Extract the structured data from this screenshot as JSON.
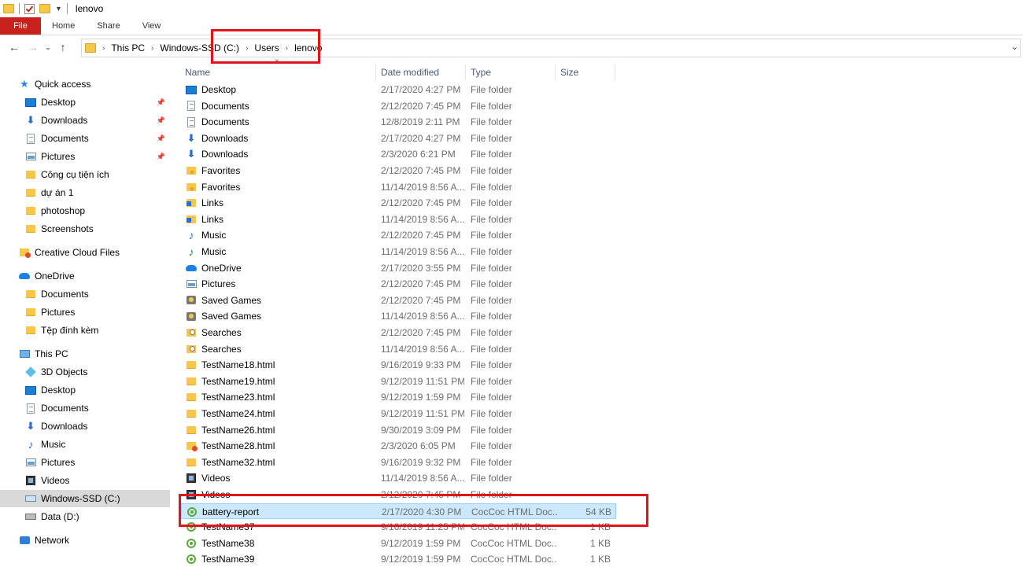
{
  "window": {
    "title": "lenovo"
  },
  "ribbon": {
    "file": "File",
    "tabs": [
      "Home",
      "Share",
      "View"
    ]
  },
  "address": {
    "crumbs": [
      "This PC",
      "Windows-SSD (C:)",
      "Users",
      "lenovo"
    ]
  },
  "sidebar": {
    "items": [
      {
        "label": "Quick access",
        "icon": "star-icon",
        "pinned": false
      },
      {
        "label": "Desktop",
        "icon": "desktop-icon",
        "pinned": true
      },
      {
        "label": "Downloads",
        "icon": "download-icon",
        "pinned": true
      },
      {
        "label": "Documents",
        "icon": "document-icon",
        "pinned": true
      },
      {
        "label": "Pictures",
        "icon": "pictures-icon",
        "pinned": true
      },
      {
        "label": "Công cụ tiện ích",
        "icon": "folder-icon",
        "pinned": false
      },
      {
        "label": "dự án 1",
        "icon": "folder-icon",
        "pinned": false
      },
      {
        "label": "photoshop",
        "icon": "folder-icon",
        "pinned": false
      },
      {
        "label": "Screenshots",
        "icon": "folder-icon",
        "pinned": false
      },
      {
        "label": "Creative Cloud Files",
        "icon": "creative-cloud-icon",
        "pinned": false
      },
      {
        "label": "OneDrive",
        "icon": "cloud-icon",
        "pinned": false
      },
      {
        "label": "Documents",
        "icon": "folder-icon",
        "pinned": false
      },
      {
        "label": "Pictures",
        "icon": "folder-icon",
        "pinned": false
      },
      {
        "label": "Tệp đính kèm",
        "icon": "folder-icon",
        "pinned": false
      },
      {
        "label": "This PC",
        "icon": "computer-icon",
        "pinned": false
      },
      {
        "label": "3D Objects",
        "icon": "3d-objects-icon",
        "pinned": false
      },
      {
        "label": "Desktop",
        "icon": "desktop-icon",
        "pinned": false
      },
      {
        "label": "Documents",
        "icon": "document-icon",
        "pinned": false
      },
      {
        "label": "Downloads",
        "icon": "download-icon",
        "pinned": false
      },
      {
        "label": "Music",
        "icon": "music-icon",
        "pinned": false
      },
      {
        "label": "Pictures",
        "icon": "pictures-icon",
        "pinned": false
      },
      {
        "label": "Videos",
        "icon": "videos-icon",
        "pinned": false
      },
      {
        "label": "Windows-SSD (C:)",
        "icon": "drive-c-icon",
        "pinned": false,
        "selected": true
      },
      {
        "label": "Data (D:)",
        "icon": "drive-icon",
        "pinned": false
      },
      {
        "label": "Network",
        "icon": "network-icon",
        "pinned": false
      }
    ]
  },
  "columns": {
    "name": "Name",
    "date": "Date modified",
    "type": "Type",
    "size": "Size"
  },
  "files": [
    {
      "name": "Desktop",
      "date": "2/17/2020 4:27 PM",
      "type": "File folder",
      "size": "",
      "icon": "desktop-icon"
    },
    {
      "name": "Documents",
      "date": "2/12/2020 7:45 PM",
      "type": "File folder",
      "size": "",
      "icon": "document-icon"
    },
    {
      "name": "Documents",
      "date": "12/8/2019 2:11 PM",
      "type": "File folder",
      "size": "",
      "icon": "document-icon"
    },
    {
      "name": "Downloads",
      "date": "2/17/2020 4:27 PM",
      "type": "File folder",
      "size": "",
      "icon": "download-icon"
    },
    {
      "name": "Downloads",
      "date": "2/3/2020 6:21 PM",
      "type": "File folder",
      "size": "",
      "icon": "download-icon"
    },
    {
      "name": "Favorites",
      "date": "2/12/2020 7:45 PM",
      "type": "File folder",
      "size": "",
      "icon": "favorites-icon"
    },
    {
      "name": "Favorites",
      "date": "11/14/2019 8:56 A...",
      "type": "File folder",
      "size": "",
      "icon": "favorites-icon"
    },
    {
      "name": "Links",
      "date": "2/12/2020 7:45 PM",
      "type": "File folder",
      "size": "",
      "icon": "links-icon"
    },
    {
      "name": "Links",
      "date": "11/14/2019 8:56 A...",
      "type": "File folder",
      "size": "",
      "icon": "links-icon"
    },
    {
      "name": "Music",
      "date": "2/12/2020 7:45 PM",
      "type": "File folder",
      "size": "",
      "icon": "music-icon"
    },
    {
      "name": "Music",
      "date": "11/14/2019 8:56 A...",
      "type": "File folder",
      "size": "",
      "icon": "music-icon"
    },
    {
      "name": "OneDrive",
      "date": "2/17/2020 3:55 PM",
      "type": "File folder",
      "size": "",
      "icon": "cloud-icon"
    },
    {
      "name": "Pictures",
      "date": "2/12/2020 7:45 PM",
      "type": "File folder",
      "size": "",
      "icon": "pictures-icon"
    },
    {
      "name": "Saved Games",
      "date": "2/12/2020 7:45 PM",
      "type": "File folder",
      "size": "",
      "icon": "saved-games-icon"
    },
    {
      "name": "Saved Games",
      "date": "11/14/2019 8:56 A...",
      "type": "File folder",
      "size": "",
      "icon": "saved-games-icon"
    },
    {
      "name": "Searches",
      "date": "2/12/2020 7:45 PM",
      "type": "File folder",
      "size": "",
      "icon": "searches-icon"
    },
    {
      "name": "Searches",
      "date": "11/14/2019 8:56 A...",
      "type": "File folder",
      "size": "",
      "icon": "searches-icon"
    },
    {
      "name": "TestName18.html",
      "date": "9/16/2019 9:33 PM",
      "type": "File folder",
      "size": "",
      "icon": "folder-icon"
    },
    {
      "name": "TestName19.html",
      "date": "9/12/2019 11:51 PM",
      "type": "File folder",
      "size": "",
      "icon": "folder-icon"
    },
    {
      "name": "TestName23.html",
      "date": "9/12/2019 1:59 PM",
      "type": "File folder",
      "size": "",
      "icon": "folder-icon"
    },
    {
      "name": "TestName24.html",
      "date": "9/12/2019 11:51 PM",
      "type": "File folder",
      "size": "",
      "icon": "folder-icon"
    },
    {
      "name": "TestName26.html",
      "date": "9/30/2019 3:09 PM",
      "type": "File folder",
      "size": "",
      "icon": "folder-icon"
    },
    {
      "name": "TestName28.html",
      "date": "2/3/2020 6:05 PM",
      "type": "File folder",
      "size": "",
      "icon": "creative-cloud-icon"
    },
    {
      "name": "TestName32.html",
      "date": "9/16/2019 9:32 PM",
      "type": "File folder",
      "size": "",
      "icon": "folder-icon"
    },
    {
      "name": "Videos",
      "date": "11/14/2019 8:56 A...",
      "type": "File folder",
      "size": "",
      "icon": "videos-icon"
    },
    {
      "name": "Videos",
      "date": "2/12/2020 7:45 PM",
      "type": "File folder",
      "size": "",
      "icon": "videos-icon"
    },
    {
      "name": "battery-report",
      "date": "2/17/2020 4:30 PM",
      "type": "CocCoc HTML Doc...",
      "size": "54 KB",
      "icon": "coccoc-icon",
      "selected": true
    },
    {
      "name": "TestName37",
      "date": "9/16/2019 11:25 PM",
      "type": "CocCoc HTML Doc...",
      "size": "1 KB",
      "icon": "coccoc-icon"
    },
    {
      "name": "TestName38",
      "date": "9/12/2019 1:59 PM",
      "type": "CocCoc HTML Doc...",
      "size": "1 KB",
      "icon": "coccoc-icon"
    },
    {
      "name": "TestName39",
      "date": "9/12/2019 1:59 PM",
      "type": "CocCoc HTML Doc...",
      "size": "1 KB",
      "icon": "coccoc-icon"
    }
  ]
}
